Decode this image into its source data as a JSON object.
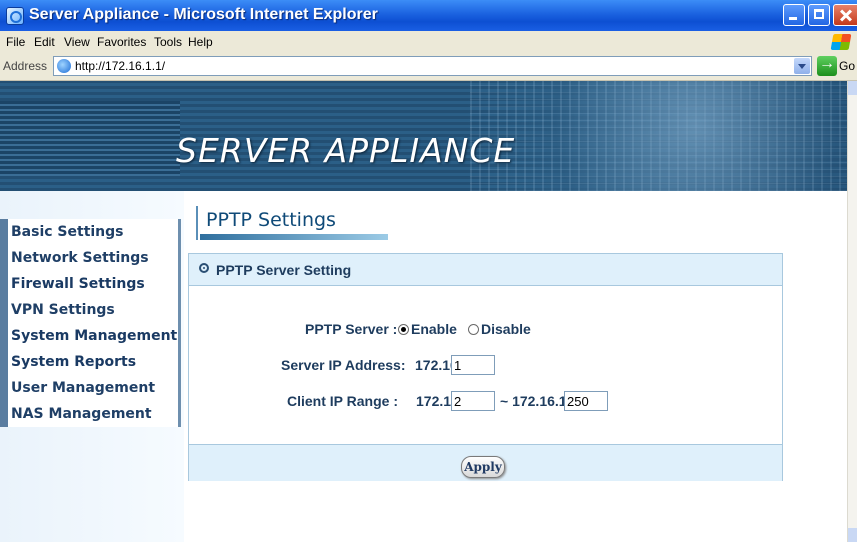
{
  "window": {
    "title": "Server Appliance - Microsoft Internet Explorer"
  },
  "menu": [
    "File",
    "Edit",
    "View",
    "Favorites",
    "Tools",
    "Help"
  ],
  "address": {
    "label": "Address",
    "url": "http://172.16.1.1/",
    "go_label": "Go"
  },
  "banner": {
    "brand": "SERVER APPLIANCE"
  },
  "sidebar": {
    "items": [
      "Basic Settings",
      "Network Settings",
      "Firewall Settings",
      "VPN Settings",
      "System Management",
      "System Reports",
      "User Management",
      "NAS Management"
    ]
  },
  "page": {
    "title": "PPTP Settings",
    "panel_header": "PPTP Server Setting",
    "pptp_server_label": "PPTP Server :",
    "enable_label": "Enable",
    "disable_label": "Disable",
    "pptp_enabled": true,
    "server_ip_label": "Server IP Address:",
    "server_ip_prefix": "172.16.1.",
    "server_ip_value": "1",
    "client_range_label": "Client IP Range :",
    "client_start_prefix": "172.16.1.",
    "client_start_value": "2",
    "client_range_sep": "~ 172.16.1.",
    "client_end_value": "250",
    "apply_label": "Apply"
  }
}
